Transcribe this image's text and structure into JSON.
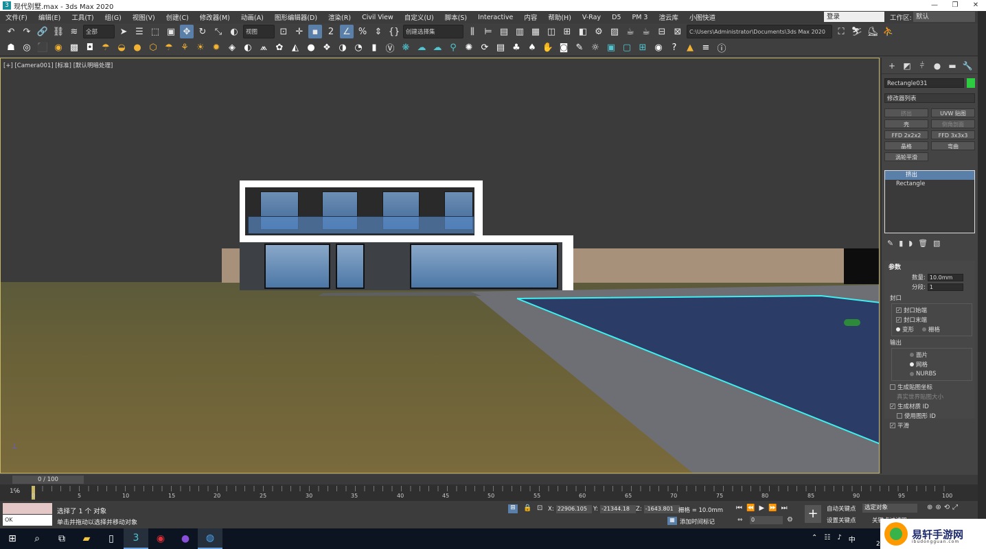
{
  "window": {
    "title": "现代别墅.max - 3ds Max 2020",
    "app_letter": "3"
  },
  "menu": {
    "items": [
      "文件(F)",
      "编辑(E)",
      "工具(T)",
      "组(G)",
      "视图(V)",
      "创建(C)",
      "修改器(M)",
      "动画(A)",
      "图形编辑器(D)",
      "渲染(R)",
      "Civil View",
      "自定义(U)",
      "脚本(S)",
      "Interactive",
      "内容",
      "帮助(H)",
      "V-Ray",
      "D5",
      "PM 3",
      "渲云库",
      "小图快道"
    ],
    "login": "登录",
    "workspace_label": "工作区:",
    "workspace": "默认"
  },
  "toolbar": {
    "selection_filter": "全部",
    "coordinate_system": "视图",
    "named_selection": "创建选择集",
    "project_path": "C:\\Users\\Administrator\\Documents\\3ds Max 2020"
  },
  "viewport": {
    "label": "[+] [Camera001] [标准] [默认明暗处理]"
  },
  "command_panel": {
    "object_name": "Rectangle031",
    "object_color": "#2ecc40",
    "modifier_list": "修改器列表",
    "buttons": [
      {
        "label": "挤出",
        "dim": true
      },
      {
        "label": "UVW 贴图",
        "dim": false
      },
      {
        "label": "壳",
        "dim": false
      },
      {
        "label": "倒角剖面",
        "dim": true
      },
      {
        "label": "FFD 2x2x2",
        "dim": false
      },
      {
        "label": "FFD 3x3x3",
        "dim": false
      },
      {
        "label": "晶格",
        "dim": false
      },
      {
        "label": "弯曲",
        "dim": false
      },
      {
        "label": "涡轮平滑",
        "dim": false
      }
    ],
    "stack": {
      "selected": "挤出",
      "base": "Rectangle"
    },
    "params": {
      "title": "参数",
      "amount_label": "数量:",
      "amount": "10.0mm",
      "segments_label": "分段:",
      "segments": "1",
      "capping_label": "封口",
      "cap_start": "封口始端",
      "cap_end": "封口末端",
      "morph": "变形",
      "grid": "栅格",
      "output_label": "输出",
      "patch": "面片",
      "mesh": "网格",
      "nurbs": "NURBS",
      "gen_mapping": "生成贴图坐标",
      "real_world": "真实世界贴图大小",
      "gen_matid": "生成材质 ID",
      "use_shape_id": "使用图形 ID",
      "smooth": "平滑"
    }
  },
  "timeline": {
    "frame_display": "0 / 100",
    "ticks": [
      "0",
      "5",
      "10",
      "15",
      "20",
      "25",
      "30",
      "35",
      "40",
      "45",
      "50",
      "55",
      "60",
      "65",
      "70",
      "75",
      "80",
      "85",
      "90",
      "95",
      "100"
    ]
  },
  "status": {
    "ok_label": "OK",
    "selection_text": "选择了 1 个 对象",
    "prompt_text": "单击并拖动以选择并移动对象",
    "x_label": "X:",
    "x": "22906.105",
    "y_label": "Y:",
    "y": "-21344.18",
    "z_label": "Z:",
    "z": "-1643.801",
    "grid": "栅格 = 10.0mm",
    "add_time_tag": "添加时间标记",
    "frame_value": "0",
    "auto_key": "自动关键点",
    "set_key": "设置关键点",
    "selection_set": "选定对象",
    "key_filters": "关键点过滤器"
  },
  "taskbar": {
    "ime": "中",
    "year": "20"
  },
  "watermark": {
    "text": "易轩手游网",
    "sub": "ibudongguan.com"
  }
}
